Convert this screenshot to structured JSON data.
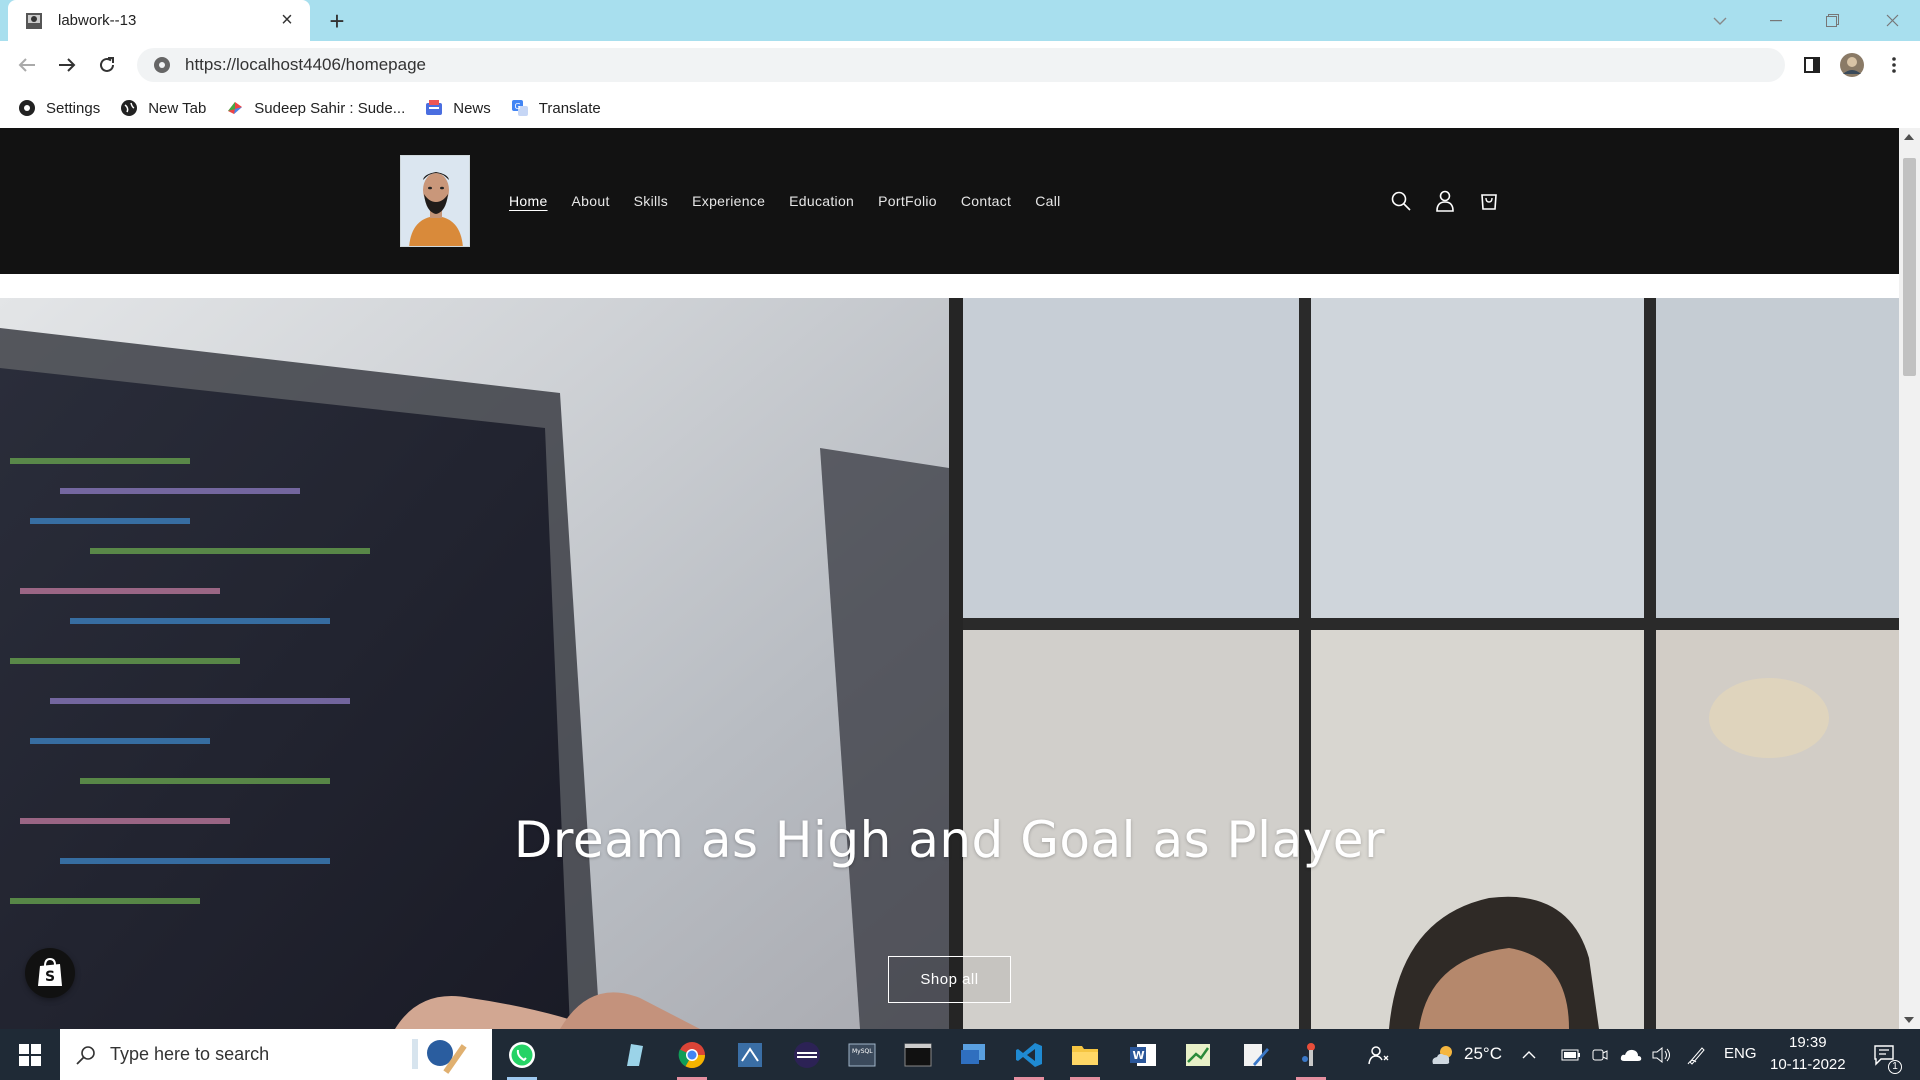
{
  "browser": {
    "tab_title": "labwork--13",
    "url": "https://localhost4406/homepage",
    "bookmarks": [
      {
        "label": "Settings",
        "icon": "settings-gear-icon"
      },
      {
        "label": "New Tab",
        "icon": "globe-icon"
      },
      {
        "label": "Sudeep Sahir : Sude...",
        "icon": "bookmark-brand-icon"
      },
      {
        "label": "News",
        "icon": "news-icon"
      },
      {
        "label": "Translate",
        "icon": "translate-icon"
      }
    ]
  },
  "site": {
    "nav": [
      {
        "label": "Home",
        "active": true
      },
      {
        "label": "About"
      },
      {
        "label": "Skills"
      },
      {
        "label": "Experience"
      },
      {
        "label": "Education"
      },
      {
        "label": "PortFolio"
      },
      {
        "label": "Contact"
      },
      {
        "label": "Call"
      }
    ],
    "hero": {
      "title": "Dream as High and Goal as Player",
      "button_label": "Shop all"
    }
  },
  "taskbar": {
    "search_placeholder": "Type here to search",
    "weather": "25°C",
    "language": "ENG",
    "time": "19:39",
    "date": "10-11-2022",
    "notification_count": "1"
  },
  "colors": {
    "tabstrip": "#a8dfee",
    "site_header": "#121212",
    "taskbar": "#1f2a36"
  }
}
